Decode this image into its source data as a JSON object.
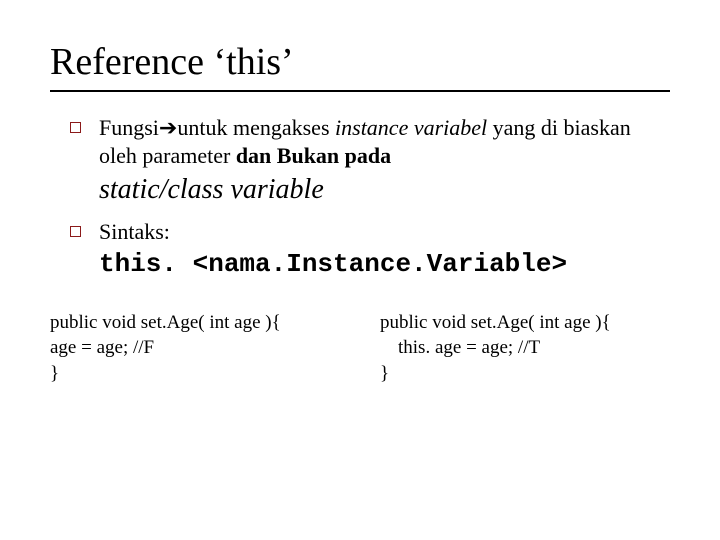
{
  "title": "Reference ‘this’",
  "bullet1": {
    "part1": "Fungsi",
    "arrow": "➔",
    "part2": "untuk mengakses ",
    "italic": "instance variabel",
    "part3": " yang di biaskan oleh parameter ",
    "bold": "dan Bukan pada",
    "subline": "static/class variable"
  },
  "bullet2": {
    "label": "Sintaks:",
    "code": "this. <nama.Instance.Variable>"
  },
  "code_left": {
    "l1": "public void set.Age( int age ){",
    "l2": "age = age; //F",
    "l3": "}"
  },
  "code_right": {
    "l1": "public void set.Age( int age ){",
    "l2": "this. age = age; //T",
    "l3": "}"
  }
}
